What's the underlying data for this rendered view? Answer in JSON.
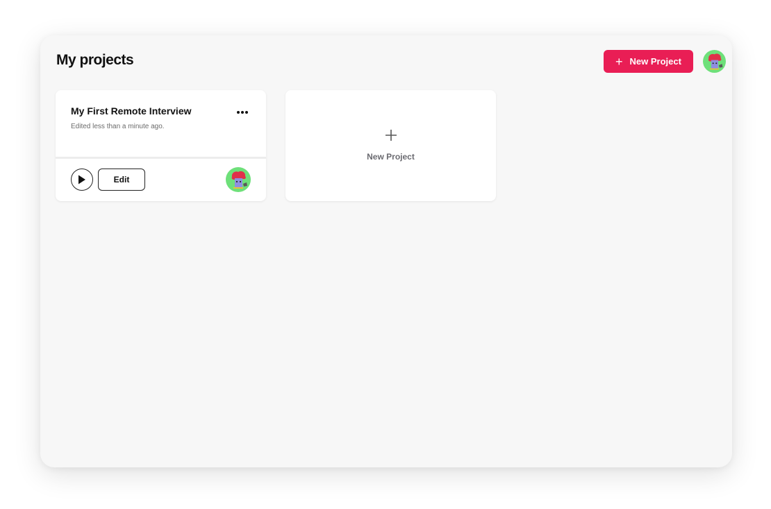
{
  "header": {
    "title": "My projects",
    "new_project_label": "New Project",
    "new_project_icon": "plus-icon",
    "accent_color": "#e91e55"
  },
  "projects": [
    {
      "title": "My First Remote Interview",
      "subtitle": "Edited less than a minute ago.",
      "more_icon": "more-horizontal-icon",
      "play_icon": "play-icon",
      "edit_label": "Edit",
      "avatar_icon": "avatar-icon"
    }
  ],
  "new_card": {
    "label": "New Project",
    "icon": "plus-icon"
  },
  "user": {
    "avatar_icon": "avatar-icon"
  }
}
